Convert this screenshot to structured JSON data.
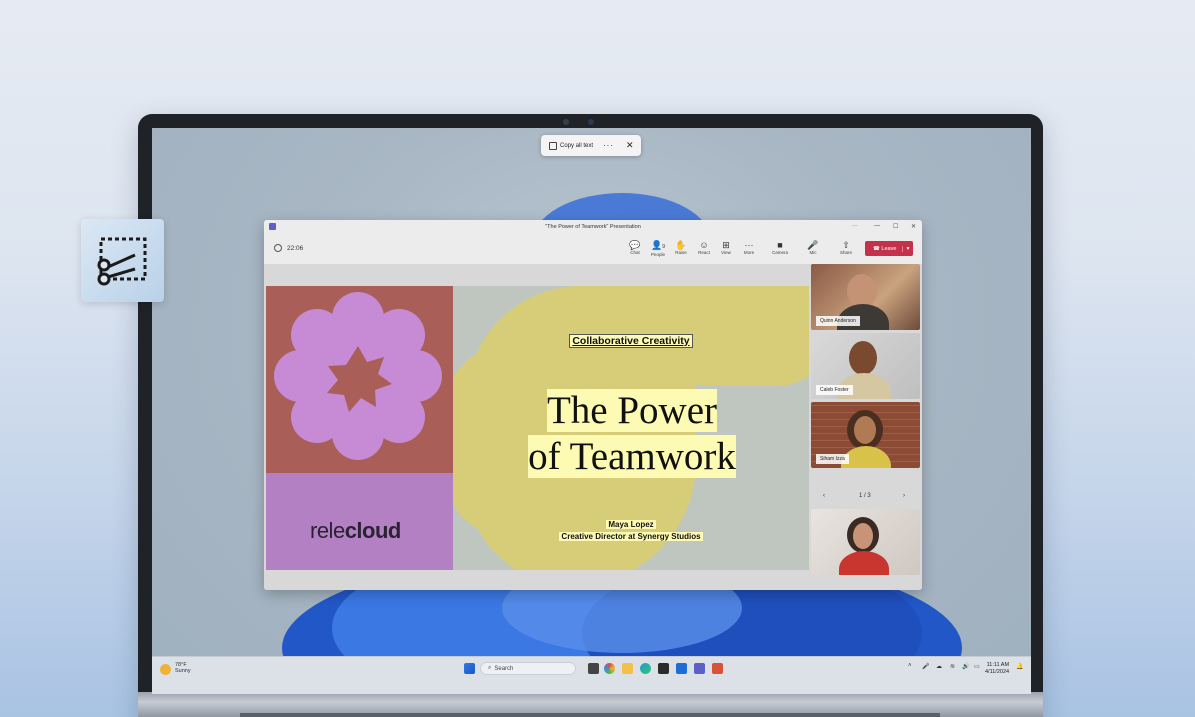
{
  "snip_toolbar": {
    "copy_label": "Copy all text",
    "more_label": "···",
    "close_label": "✕"
  },
  "teams": {
    "window_title": "\"The Power of Teamwork\" Presentation",
    "elapsed": "22:06",
    "toolbar": [
      {
        "id": "chat",
        "icon": "chat-icon",
        "glyph": "💬",
        "label": "Chat"
      },
      {
        "id": "people",
        "icon": "people-icon",
        "glyph": "👤",
        "label": "People",
        "count": "9"
      },
      {
        "id": "raise",
        "icon": "raise-hand-icon",
        "glyph": "✋",
        "label": "Raise"
      },
      {
        "id": "react",
        "icon": "react-icon",
        "glyph": "☺",
        "label": "React"
      },
      {
        "id": "view",
        "icon": "view-icon",
        "glyph": "⊞",
        "label": "View"
      },
      {
        "id": "more",
        "icon": "more-icon",
        "glyph": "···",
        "label": "More"
      },
      {
        "id": "camera",
        "icon": "camera-icon",
        "glyph": "■",
        "label": "Camera"
      },
      {
        "id": "mic",
        "icon": "mic-icon",
        "glyph": "🎤",
        "label": "Mic"
      },
      {
        "id": "share",
        "icon": "share-icon",
        "glyph": "⇧",
        "label": "Share"
      }
    ],
    "leave_label": "Leave",
    "window_controls": {
      "more": "···",
      "minimize": "—",
      "maximize": "☐",
      "close": "✕"
    }
  },
  "slide": {
    "kicker": "Collaborative Creativity",
    "title_line1": "The Power",
    "title_line2": "of Teamwork",
    "presenter_name": "Maya Lopez",
    "presenter_role": "Creative Director at Synergy Studios",
    "brand_light": "rele",
    "brand_bold": "cloud"
  },
  "participants": [
    {
      "name": "Quinn Anderson"
    },
    {
      "name": "Caleb Foster"
    },
    {
      "name": "Siham Izza"
    },
    {
      "name": ""
    }
  ],
  "pager": {
    "text": "1 / 3",
    "prev": "‹",
    "next": "›"
  },
  "taskbar": {
    "weather_temp": "78°F",
    "weather_desc": "Sunny",
    "search_label": "Search",
    "time": "11:11 AM",
    "date": "4/11/2024"
  },
  "colors": {
    "leave": "#c4314b",
    "slide_red": "#a95e58",
    "slide_purple": "#b480c4",
    "slide_yellow": "#d7cd78",
    "highlight": "#fdfbb3",
    "teams_purple": "#5b5fc7"
  }
}
